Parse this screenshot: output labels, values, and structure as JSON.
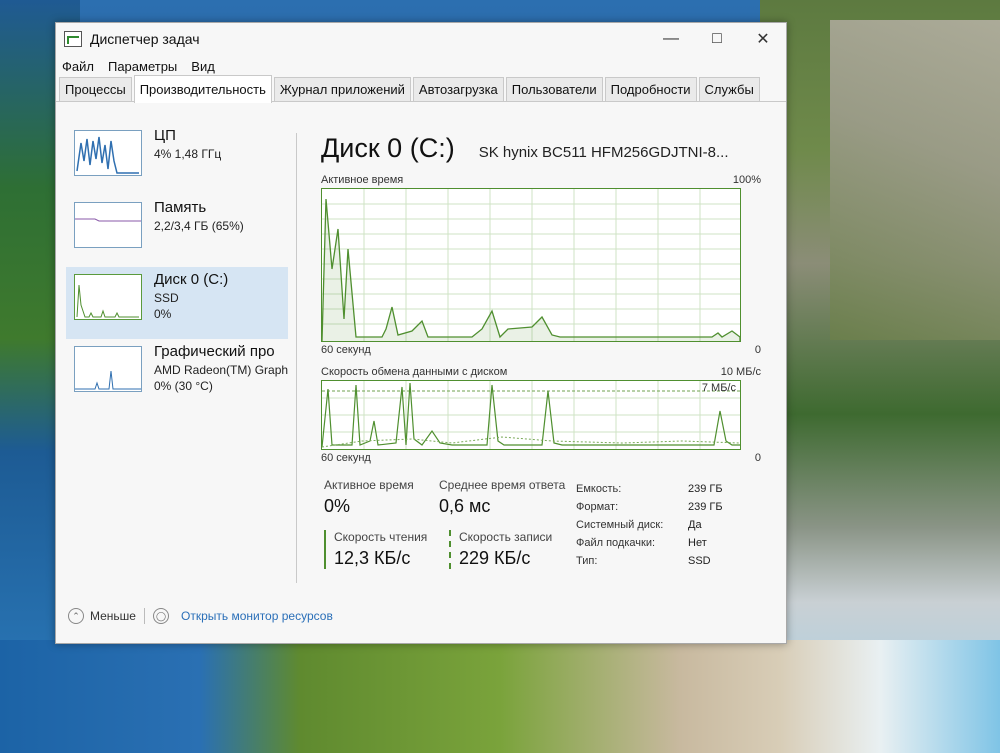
{
  "window": {
    "title": "Диспетчер задач"
  },
  "menu": [
    "Файл",
    "Параметры",
    "Вид"
  ],
  "tabs": [
    "Процессы",
    "Производительность",
    "Журнал приложений",
    "Автозагрузка",
    "Пользователи",
    "Подробности",
    "Службы"
  ],
  "sidebar": {
    "items": [
      {
        "name": "ЦП",
        "line1": "4% 1,48 ГГц",
        "line2": ""
      },
      {
        "name": "Память",
        "line1": "2,2/3,4 ГБ (65%)",
        "line2": ""
      },
      {
        "name": "Диск 0 (C:)",
        "line1": "SSD",
        "line2": "0%"
      },
      {
        "name": "Графический про",
        "line1": "AMD Radeon(TM) Graph",
        "line2": "0% (30 °C)"
      }
    ]
  },
  "main": {
    "title": "Диск 0 (C:)",
    "model": "SK hynix BC511 HFM256GDJTNI-8...",
    "graph1": {
      "label": "Активное время",
      "max": "100%",
      "time": "60 секунд",
      "min": "0"
    },
    "graph2": {
      "label": "Скорость обмена данными с диском",
      "max": "10 МБ/с",
      "inner_max": "7 МБ/с",
      "time": "60 секунд",
      "min": "0"
    },
    "stats": {
      "active_label": "Активное время",
      "active_value": "0%",
      "resp_label": "Среднее время ответа",
      "resp_value": "0,6 мс",
      "read_label": "Скорость чтения",
      "read_value": "12,3 КБ/с",
      "write_label": "Скорость записи",
      "write_value": "229 КБ/с"
    },
    "props": [
      {
        "k": "Емкость:",
        "v": "239 ГБ"
      },
      {
        "k": "Формат:",
        "v": "239 ГБ"
      },
      {
        "k": "Системный диск:",
        "v": "Да"
      },
      {
        "k": "Файл подкачки:",
        "v": "Нет"
      },
      {
        "k": "Тип:",
        "v": "SSD"
      }
    ]
  },
  "footer": {
    "less": "Меньше",
    "monitor": "Открыть монитор ресурсов"
  }
}
